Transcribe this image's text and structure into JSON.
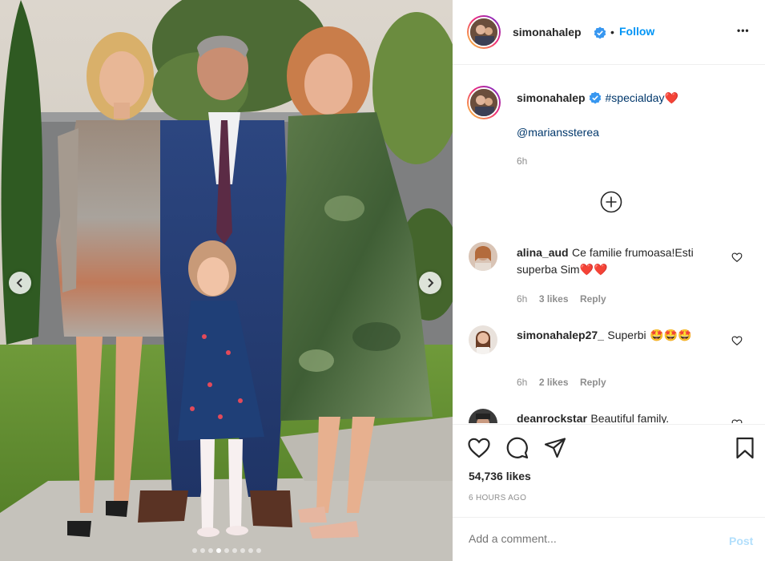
{
  "post": {
    "username": "simonahalep",
    "follow_label": "Follow",
    "more_label": "•••",
    "separator": "•",
    "caption": {
      "username": "simonahalep",
      "hashtag": "#specialday",
      "emoji": "❤️",
      "mention": "@marianssterea",
      "time": "6h"
    },
    "load_more_icon": "plus-circle-icon",
    "comments": [
      {
        "username": "alina_aud",
        "text": "Ce familie frumoasa!Esti superba Sim",
        "emoji": "❤️❤️",
        "time": "6h",
        "likes": "3 likes",
        "reply": "Reply"
      },
      {
        "username": "simonahalep27_",
        "text": "Superbi",
        "emoji": "🤩🤩🤩",
        "time": "6h",
        "likes": "2 likes",
        "reply": "Reply"
      },
      {
        "username": "deanrockstar",
        "text": "Beautiful family.",
        "emoji": "",
        "time": "",
        "likes": "",
        "reply": ""
      }
    ],
    "likes_count": "54,736 likes",
    "time_ago": "6 HOURS AGO",
    "add_comment_placeholder": "Add a comment...",
    "post_label": "Post"
  },
  "carousel": {
    "slide_count": 9,
    "active_index": 3
  },
  "colors": {
    "follow_blue": "#0095f6",
    "verified_blue": "#3897f0",
    "muted": "#8e8e8e",
    "like_red": "#ed4956"
  }
}
